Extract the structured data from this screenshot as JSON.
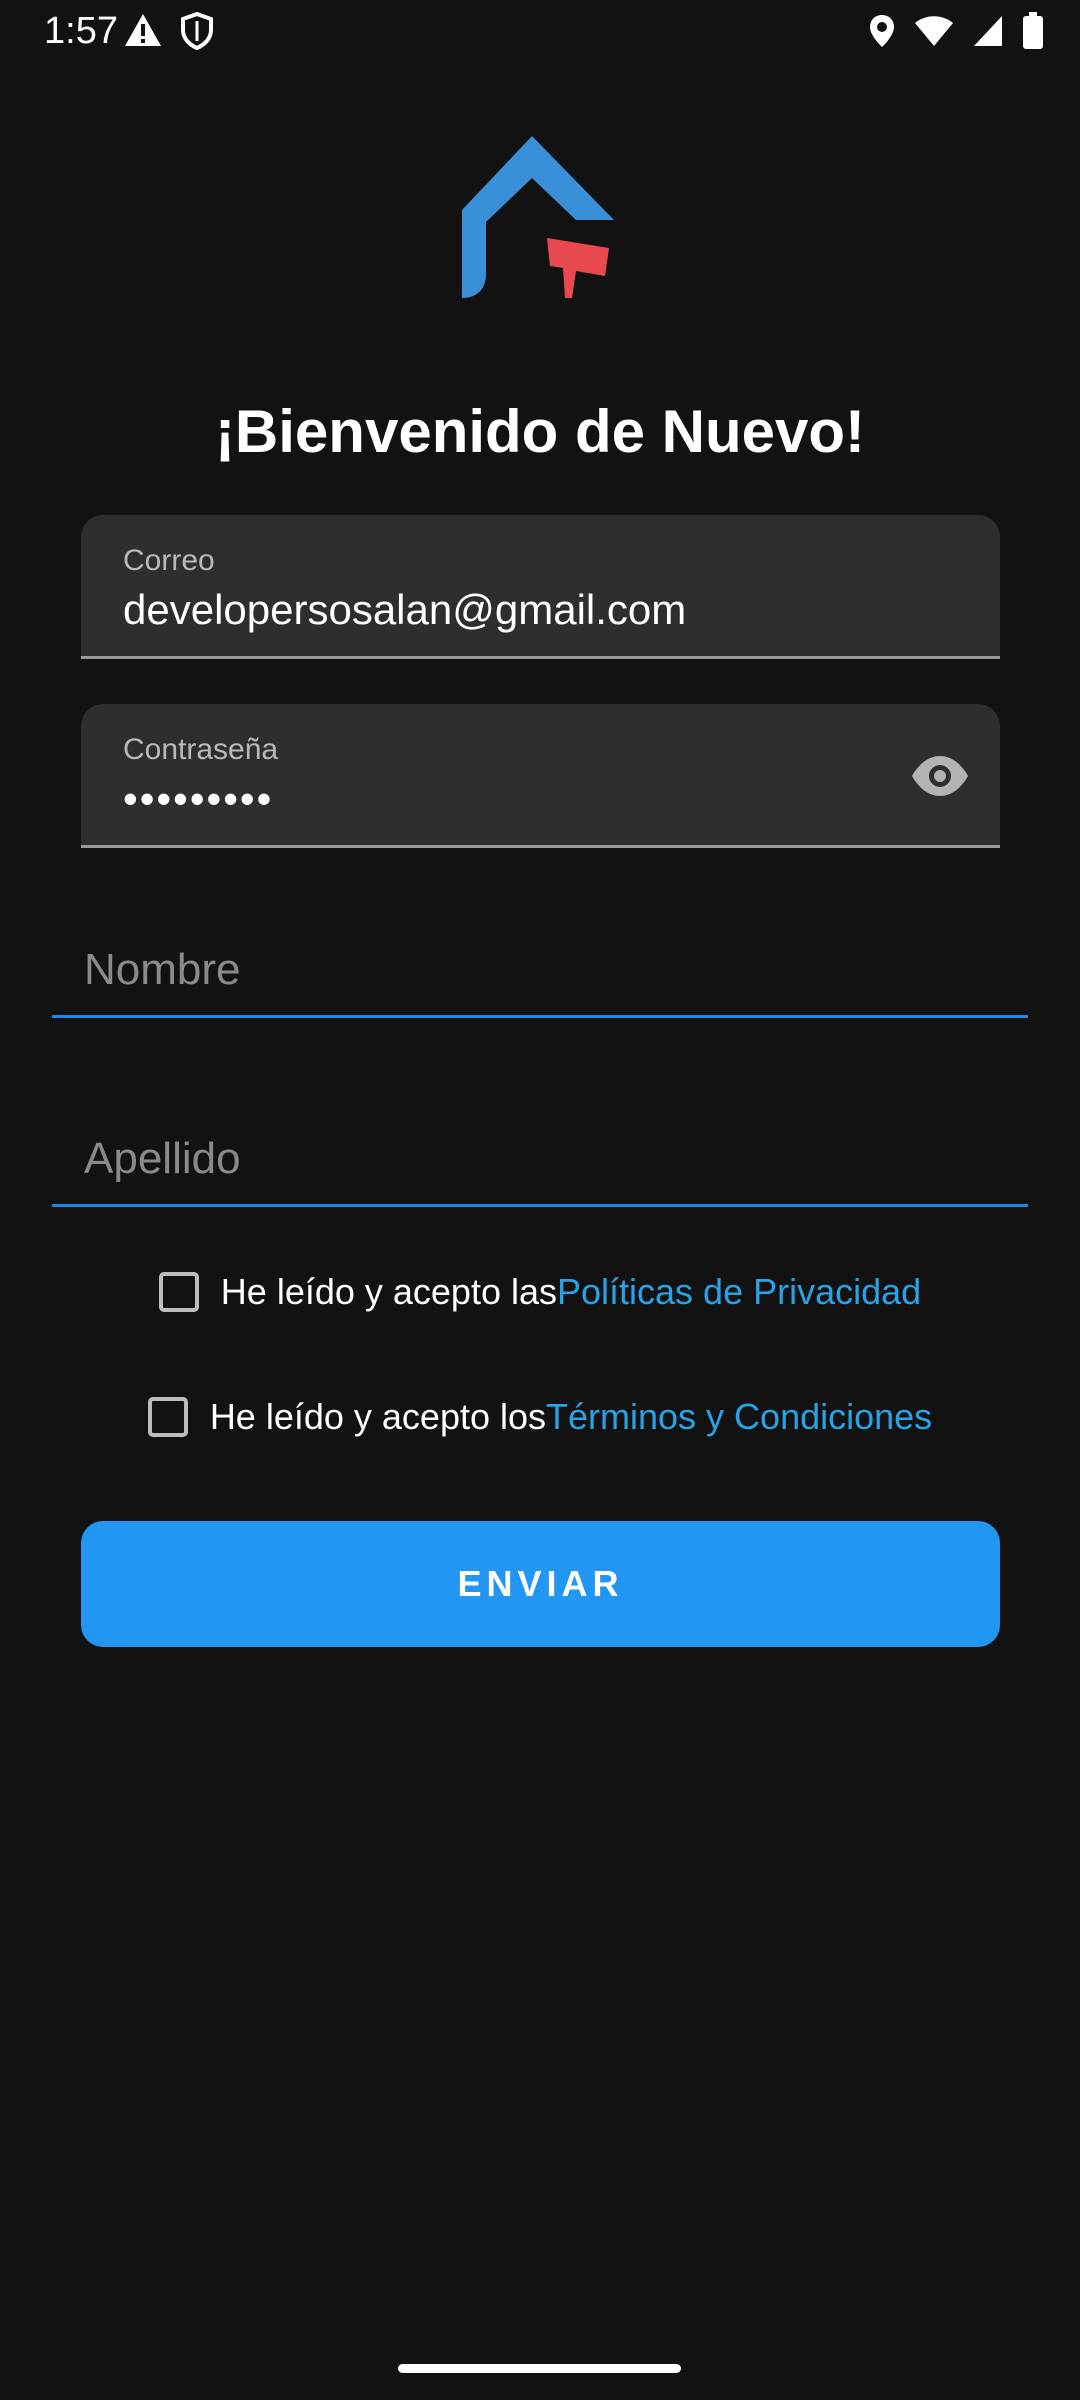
{
  "status_bar": {
    "time": "1:57",
    "left_icons": [
      "alert-icon",
      "shield-icon"
    ],
    "right_icons": [
      "location-icon",
      "wifi-icon",
      "signal-icon",
      "battery-icon"
    ]
  },
  "logo": {
    "name": "house-mailbox-logo",
    "colors": {
      "house": "#3a8fd9",
      "flag": "#e84a4f"
    }
  },
  "welcome": {
    "title": "¡Bienvenido de Nuevo!"
  },
  "form": {
    "email": {
      "label": "Correo",
      "value": "developersosalan@gmail.com"
    },
    "password": {
      "label": "Contraseña",
      "value": "•••••••••",
      "toggle_icon": "eye-icon"
    },
    "first_name": {
      "placeholder": "Nombre"
    },
    "last_name": {
      "placeholder": "Apellido"
    },
    "privacy": {
      "text": "He leído y acepto las ",
      "link": "Políticas de Privacidad",
      "checked": false
    },
    "terms": {
      "text": "He leído y acepto los ",
      "link": "Términos y Condiciones",
      "checked": false
    },
    "submit_label": "ENVIAR"
  },
  "colors": {
    "background": "#121213",
    "field_background": "#2e2e30",
    "accent": "#2196f3",
    "link": "#29a3e6",
    "underline": "#1e88e5"
  }
}
